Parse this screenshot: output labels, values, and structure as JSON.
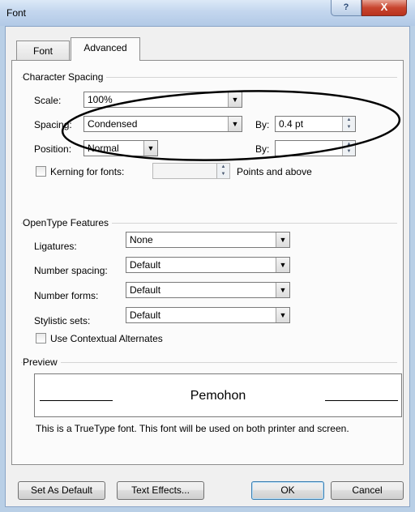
{
  "window": {
    "title": "Font",
    "help_glyph": "?",
    "close_glyph": "X"
  },
  "tabs": [
    {
      "label": "Font",
      "selected": false
    },
    {
      "label": "Advanced",
      "selected": true
    }
  ],
  "character_spacing": {
    "heading": "Character Spacing",
    "scale": {
      "label": "Scale:",
      "value": "100%"
    },
    "spacing": {
      "label": "Spacing:",
      "value": "Condensed"
    },
    "spacing_by": {
      "label": "By:",
      "value": "0.4 pt"
    },
    "position": {
      "label": "Position:",
      "value": "Normal"
    },
    "position_by": {
      "label": "By:",
      "value": ""
    },
    "kerning": {
      "label": "Kerning for fonts:",
      "value": "",
      "suffix": "Points and above",
      "checked": false
    }
  },
  "opentype": {
    "heading": "OpenType Features",
    "ligatures": {
      "label": "Ligatures:",
      "value": "None"
    },
    "number_spacing": {
      "label": "Number spacing:",
      "value": "Default"
    },
    "number_forms": {
      "label": "Number forms:",
      "value": "Default"
    },
    "stylistic_sets": {
      "label": "Stylistic sets:",
      "value": "Default"
    },
    "contextual": {
      "label": "Use Contextual Alternates",
      "checked": false
    }
  },
  "preview": {
    "heading": "Preview",
    "sample": "Pemohon",
    "note": "This is a TrueType font. This font will be used on both printer and screen."
  },
  "buttons": {
    "set_default": "Set As Default",
    "text_effects": "Text Effects...",
    "ok": "OK",
    "cancel": "Cancel"
  },
  "icons": {
    "dropdown": "chevron-down-icon",
    "spin_up": "spin-up-icon",
    "spin_down": "spin-down-icon"
  },
  "colors": {
    "annotation": "#000000",
    "titlebar": "#c3d6ee",
    "close": "#c8452f"
  }
}
